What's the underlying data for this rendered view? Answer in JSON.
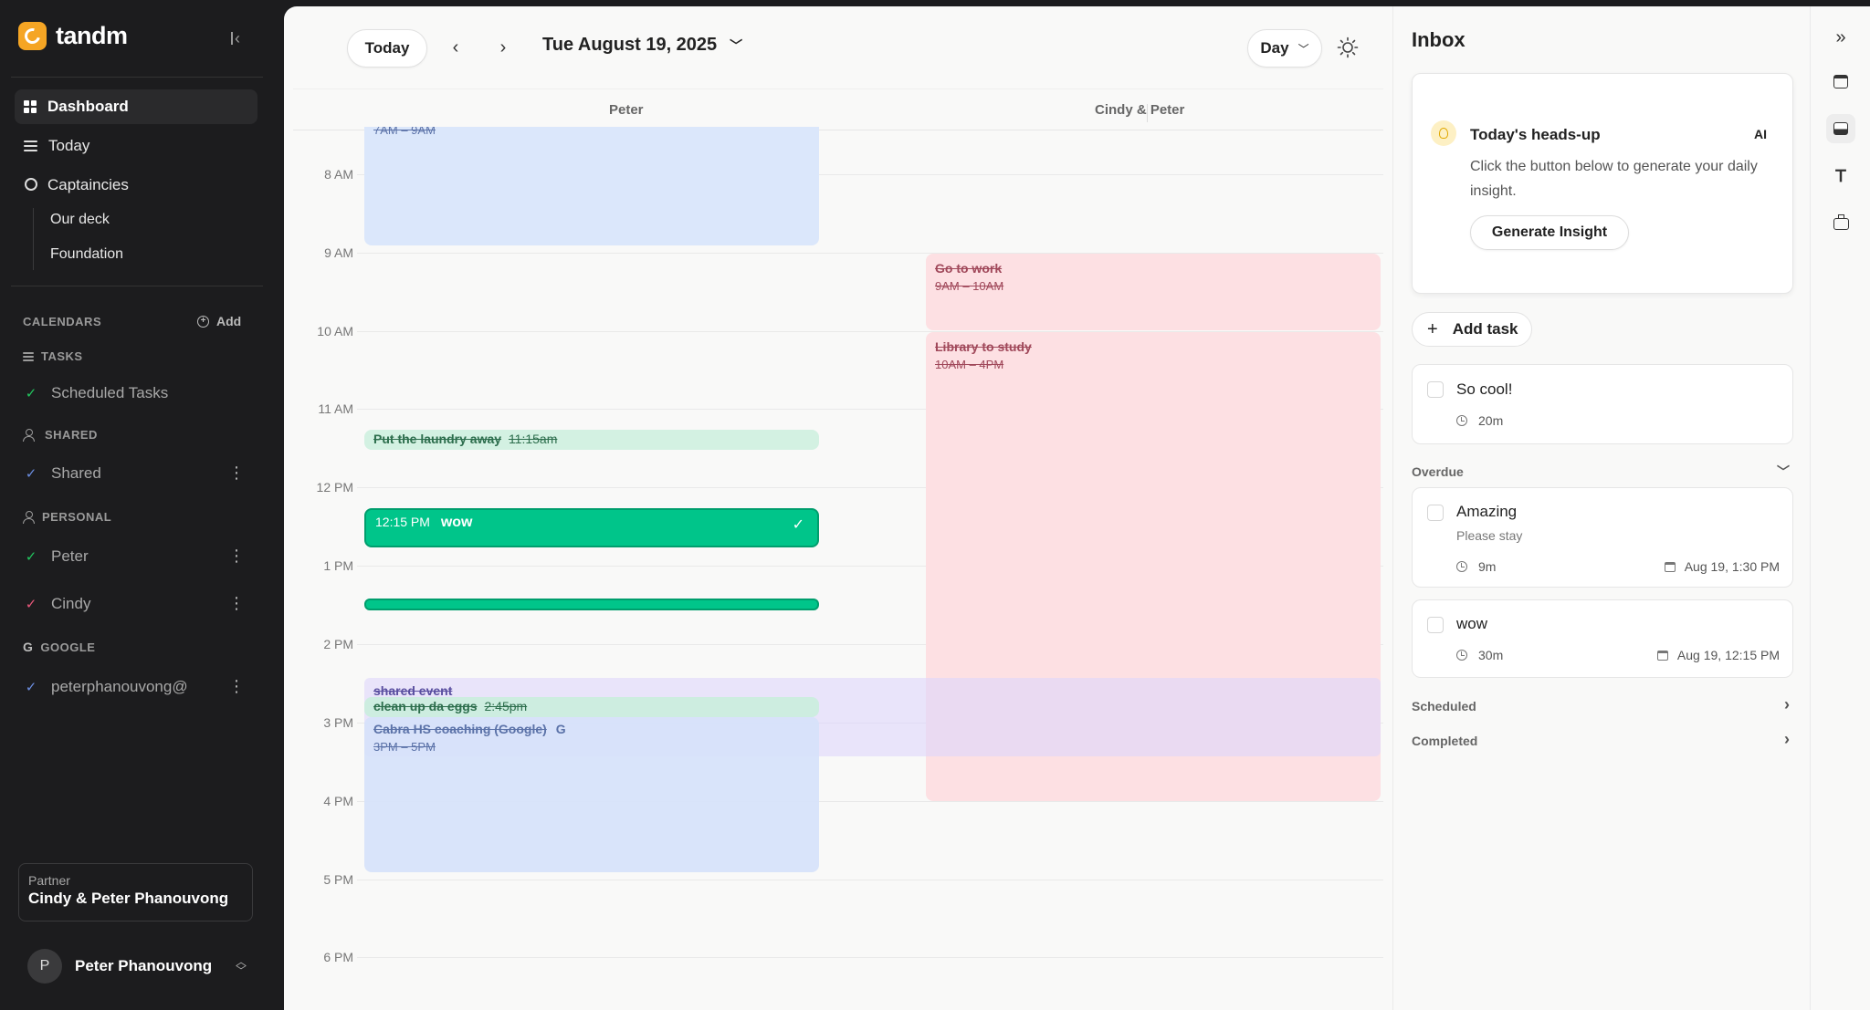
{
  "brand": {
    "name": "tandm"
  },
  "nav": {
    "dashboard": "Dashboard",
    "today": "Today",
    "captaincies": "Captaincies",
    "our_deck": "Our deck",
    "foundation": "Foundation"
  },
  "calendars": {
    "heading": "CALENDARS",
    "add_label": "Add",
    "tasks_heading": "TASKS",
    "scheduled_tasks": "Scheduled Tasks",
    "shared_heading": "SHARED",
    "shared": "Shared",
    "personal_heading": "PERSONAL",
    "peter": "Peter",
    "cindy": "Cindy",
    "google_heading": "GOOGLE",
    "google_account": "peterphanouvong@",
    "colors": {
      "scheduled": "#22c55e",
      "shared": "#6b8de0",
      "peter": "#22c55e",
      "cindy": "#e8577a",
      "google": "#6b8de0"
    }
  },
  "partner": {
    "label": "Partner",
    "name": "Cindy & Peter Phanouvong"
  },
  "user": {
    "initial": "P",
    "name": "Peter Phanouvong"
  },
  "toolbar": {
    "today_label": "Today",
    "date_title": "Tue August 19, 2025",
    "view_label": "Day"
  },
  "columns": {
    "left": "Peter",
    "right": "Cindy & Peter"
  },
  "hours": [
    "8 AM",
    "9 AM",
    "10 AM",
    "11 AM",
    "12 PM",
    "1 PM",
    "2 PM",
    "3 PM",
    "4 PM",
    "5 PM",
    "6 PM"
  ],
  "events": {
    "morning_time": "7AM – 9AM",
    "go_to_work": {
      "title": "Go to work",
      "time": "9AM – 10AM"
    },
    "library": {
      "title": "Library to study",
      "time": "10AM – 4PM"
    },
    "laundry": {
      "title": "Put the laundry away",
      "time": "11:15am"
    },
    "wow": {
      "time": "12:15 PM",
      "title": "wow"
    },
    "shared_event": {
      "title": "shared event"
    },
    "eggs": {
      "title": "clean up da eggs",
      "time": "2:45pm"
    },
    "cabra": {
      "title": "Cabra HS coaching (Google)",
      "badge": "G",
      "time": "3PM – 5PM"
    }
  },
  "inbox": {
    "title": "Inbox",
    "headsup": {
      "title": "Today's heads-up",
      "tag": "AI",
      "text": "Click the button below to generate your daily insight.",
      "button": "Generate Insight"
    },
    "add_task": "Add task",
    "tasks": [
      {
        "title": "So cool!",
        "duration": "20m"
      }
    ],
    "overdue_label": "Overdue",
    "overdue": [
      {
        "title": "Amazing",
        "note": "Please stay",
        "duration": "9m",
        "date": "Aug 19, 1:30 PM"
      },
      {
        "title": "wow",
        "duration": "30m",
        "date": "Aug 19, 12:15 PM"
      }
    ],
    "scheduled_label": "Scheduled",
    "completed_label": "Completed"
  }
}
